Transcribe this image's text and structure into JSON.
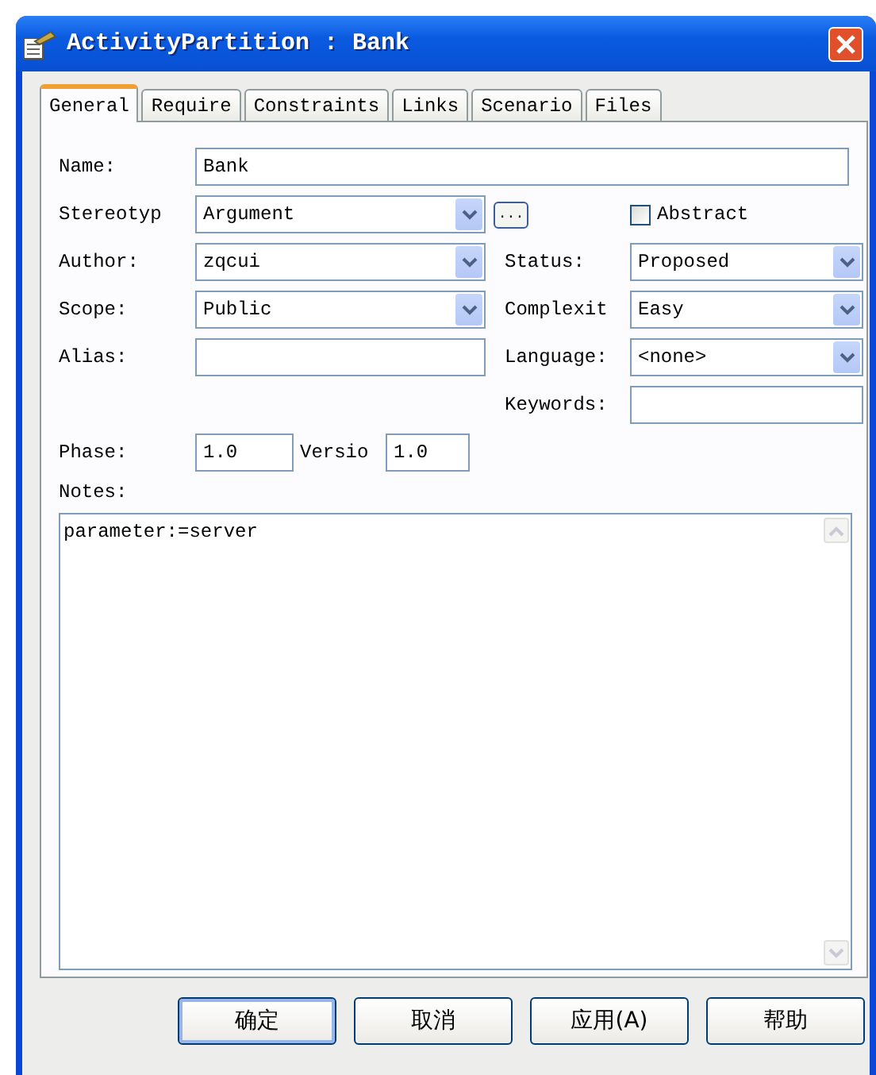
{
  "window": {
    "title": "ActivityPartition : Bank"
  },
  "tabs": [
    {
      "label": "General",
      "selected": true
    },
    {
      "label": "Require",
      "selected": false
    },
    {
      "label": "Constraints",
      "selected": false
    },
    {
      "label": "Links",
      "selected": false
    },
    {
      "label": "Scenario",
      "selected": false
    },
    {
      "label": "Files",
      "selected": false
    }
  ],
  "name": {
    "label": "Name:",
    "value": "Bank"
  },
  "stereotype": {
    "label": "Stereotyp",
    "value": "Argument",
    "browse": "..."
  },
  "abstract": {
    "label": "Abstract",
    "checked": false
  },
  "rows": [
    {
      "left": {
        "label": "Author:",
        "value": "zqcui",
        "kind": "combo"
      },
      "right": {
        "label": "Status:",
        "value": "Proposed",
        "kind": "combo"
      }
    },
    {
      "left": {
        "label": "Scope:",
        "value": "Public",
        "kind": "combo"
      },
      "right": {
        "label": "Complexit",
        "value": "Easy",
        "kind": "combo"
      }
    },
    {
      "left": {
        "label": "Alias:",
        "kind": "text"
      },
      "right": {
        "label": "Language:",
        "value": "<none>",
        "kind": "combo"
      }
    }
  ],
  "keywords": {
    "label": "Keywords:"
  },
  "phase": {
    "label": "Phase:",
    "value": "1.0"
  },
  "version": {
    "label": "Versio",
    "value": "1.0"
  },
  "notes": {
    "label": "Notes:",
    "value": "parameter:=server"
  },
  "buttons": [
    {
      "label": "确定",
      "default": true
    },
    {
      "label": "取消",
      "default": false
    },
    {
      "label": "应用(A)",
      "default": false
    },
    {
      "label": "帮助",
      "default": false
    }
  ]
}
